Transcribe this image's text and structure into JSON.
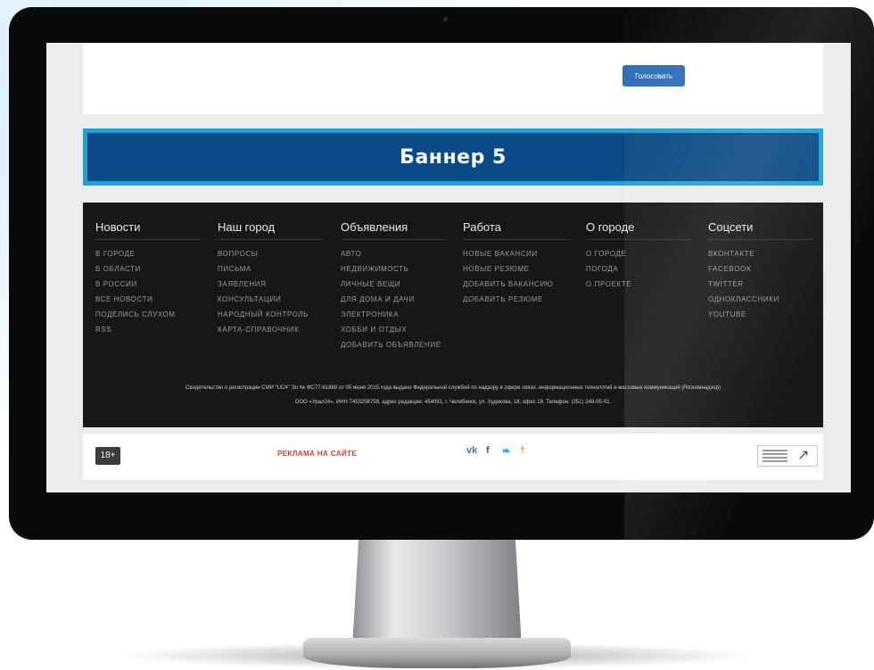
{
  "vote": {
    "button_label": "Голосовать"
  },
  "banner": {
    "text": "Баннер 5"
  },
  "footer": {
    "columns": [
      {
        "heading": "Новости",
        "links": [
          "В ГОРОДЕ",
          "В ОБЛАСТИ",
          "В РОССИИ",
          "ВСЕ НОВОСТИ",
          "ПОДЕЛИСЬ СЛУХОМ",
          "RSS"
        ]
      },
      {
        "heading": "Наш город",
        "links": [
          "ВОПРОСЫ",
          "ПИСЬМА",
          "ЗАЯВЛЕНИЯ",
          "КОНСУЛЬТАЦИИ",
          "НАРОДНЫЙ КОНТРОЛЬ",
          "КАРТА-СПРАВОЧНИК"
        ]
      },
      {
        "heading": "Объявления",
        "links": [
          "АВТО",
          "НЕДВИЖИМОСТЬ",
          "ЛИЧНЫЕ ВЕЩИ",
          "ДЛЯ ДОМА И ДАЧИ",
          "ЭЛЕКТРОНИКА",
          "ХОББИ И ОТДЫХ",
          "ДОБАВИТЬ ОБЪЯВЛЕНИЕ"
        ]
      },
      {
        "heading": "Работа",
        "links": [
          "НОВЫЕ ВАКАНСИИ",
          "НОВЫЕ РЕЗЮМЕ",
          "ДОБАВИТЬ ВАКАНСИЮ",
          "ДОБАВИТЬ РЕЗЮМЕ"
        ]
      },
      {
        "heading": "О городе",
        "links": [
          "О ГОРОДЕ",
          "ПОГОДА",
          "О ПРОЕКТЕ"
        ]
      },
      {
        "heading": "Соцсети",
        "links": [
          "ВКОНТАКТЕ",
          "FACEBOOK",
          "TWITTER",
          "ОДНОКЛАССНИКИ",
          "YOUTUBE"
        ]
      }
    ],
    "legal_line1": "Свидетельство о регистрации СМИ \"UC4\" Эл № ФС77-61868 от 05 июня 2015 года выдано Федеральной службой по надзору в сфере связи, информационных технологий и массовых коммуникаций (Роскомнадзор)",
    "legal_line2": "ООО «Урал24», ИНН 7453258758, адрес редакции: 454091, г. Челябинск, ул. Худякова, 18, офис 18. Телефон: (351) 248-05-01."
  },
  "bottom": {
    "age_badge": "18+",
    "ad_link": "РЕКЛАМА НА САЙТЕ",
    "social_icons": [
      {
        "name": "vk",
        "glyph": "vk",
        "color": "#4a76a8"
      },
      {
        "name": "facebook",
        "glyph": "f",
        "color": "#3b5998"
      },
      {
        "name": "twitter",
        "glyph": "❧",
        "color": "#1da1f2"
      },
      {
        "name": "odnoklassniki",
        "glyph": "†",
        "color": "#f39c12"
      }
    ]
  },
  "colors": {
    "banner_fill": "#0a4a86",
    "banner_border": "#1aa3d8",
    "footer_bg": "#171717",
    "button": "#2f6db8",
    "ad_link": "#e03a2a"
  }
}
